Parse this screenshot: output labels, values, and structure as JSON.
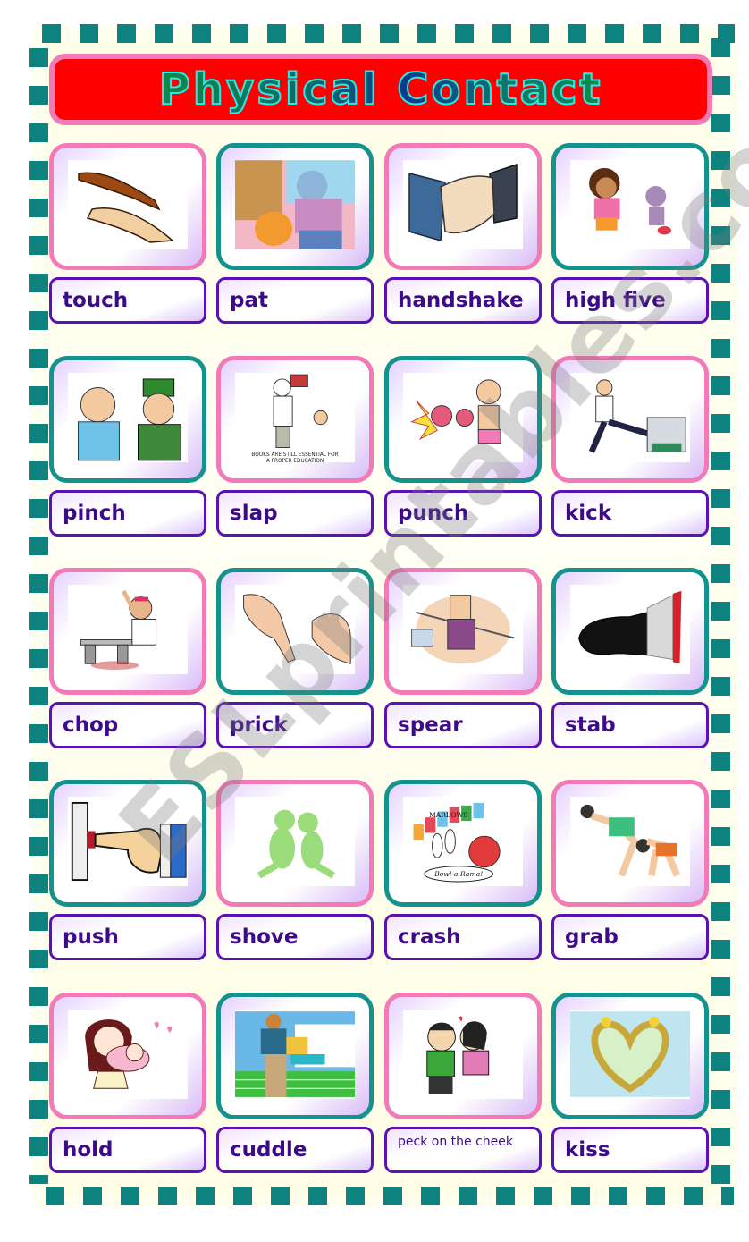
{
  "title": "Physical Contact",
  "watermark": "ESLprintables.com",
  "colors": {
    "frame_squares": "#0d827e",
    "banner_fill": "#ff0000",
    "banner_border": "#f27ab7",
    "title_outline": "#33e6e6",
    "pink_border": "#f27ab7",
    "teal_border": "#14928d",
    "label_border": "#5b12b5",
    "label_text": "#3d0b8a"
  },
  "cards": [
    {
      "label": "touch",
      "picture": "two hands reaching to touch",
      "border": "pink"
    },
    {
      "label": "pat",
      "picture": "grandma patting Garfield the cat",
      "border": "teal"
    },
    {
      "label": "handshake",
      "picture": "two hands shaking",
      "border": "pink"
    },
    {
      "label": "high five",
      "picture": "Dora and Boots giving a high five",
      "border": "teal"
    },
    {
      "label": "pinch",
      "picture": "man pinching another man's arm",
      "border": "teal"
    },
    {
      "label": "slap",
      "picture": "cartoon: man hitting boy with a book",
      "caption": "BOOKS ARE STILL ESSENTIAL FOR A PROPER EDUCATION",
      "border": "pink"
    },
    {
      "label": "punch",
      "picture": "boxer throwing a punch",
      "border": "teal"
    },
    {
      "label": "kick",
      "picture": "man kicking a copier",
      "border": "pink"
    },
    {
      "label": "chop",
      "picture": "karate man chopping a board",
      "border": "pink"
    },
    {
      "label": "prick",
      "picture": "finger being pricked",
      "border": "teal"
    },
    {
      "label": "spear",
      "picture": "man holding a spear",
      "border": "pink"
    },
    {
      "label": "stab",
      "picture": "knife handle with bloody blade",
      "border": "teal"
    },
    {
      "label": "push",
      "picture": "finger pushing a button",
      "border": "teal"
    },
    {
      "label": "shove",
      "picture": "green figure shoving another",
      "border": "pink"
    },
    {
      "label": "crash",
      "picture": "bowling ball crashing into pins",
      "sign": "MARLOWS",
      "badge": "Bowl-a-Rama!",
      "border": "teal"
    },
    {
      "label": "grab",
      "picture": "wrestlers grabbing each other",
      "border": "pink"
    },
    {
      "label": "hold",
      "picture": "mother holding a baby",
      "border": "pink"
    },
    {
      "label": "cuddle",
      "picture": "man cuddling a child",
      "border": "teal"
    },
    {
      "label": "peck on the cheek",
      "picture": "boy kissing girl on the cheek",
      "border": "pink",
      "small": true
    },
    {
      "label": "kiss",
      "picture": "two giraffes forming a heart",
      "border": "teal"
    }
  ]
}
